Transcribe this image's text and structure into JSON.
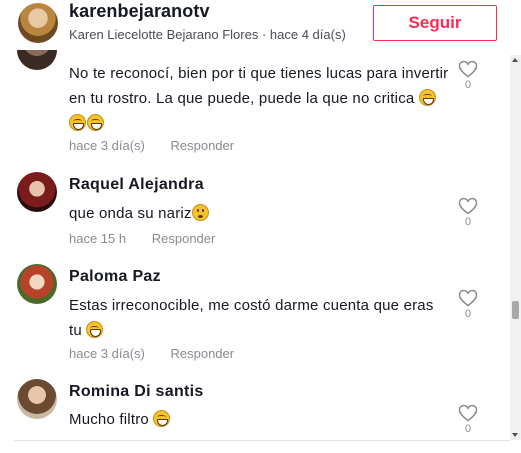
{
  "header": {
    "username": "karenbejaranotv",
    "display_name": "Karen Liecelotte Bejarano Flores",
    "separator": " · ",
    "posted": "hace 4 día(s)",
    "follow_label": "Seguir"
  },
  "comments": [
    {
      "name": "",
      "text": "No te reconocí, bien por ti que tienes lucas para invertir en tu rostro. La que puede, puede la que no critica ",
      "emojis": [
        "grin-squint",
        "grin-squint",
        "grin-squint"
      ],
      "time": "hace 3 día(s)",
      "reply": "Responder",
      "likes": "0"
    },
    {
      "name": "Raquel Alejandra",
      "text": "que onda su nariz",
      "emojis": [
        "flushed"
      ],
      "time": "hace 15 h",
      "reply": "Responder",
      "likes": "0"
    },
    {
      "name": "Paloma Paz",
      "text": "Estas irreconocible, me costó darme cuenta que eras tu ",
      "emojis": [
        "grin"
      ],
      "time": "hace 3 día(s)",
      "reply": "Responder",
      "likes": "0"
    },
    {
      "name": "Romina Di santis",
      "text": "Mucho filtro ",
      "emojis": [
        "grin-squint"
      ],
      "time": "",
      "reply": "",
      "likes": "0"
    }
  ],
  "colors": {
    "accent": "#fe2c55",
    "text_primary": "#161823",
    "text_muted": "#8a8b91"
  },
  "icons": {
    "like": "heart-outline-icon",
    "scroll_up": "chevron-up-icon",
    "scroll_down": "chevron-down-icon"
  }
}
